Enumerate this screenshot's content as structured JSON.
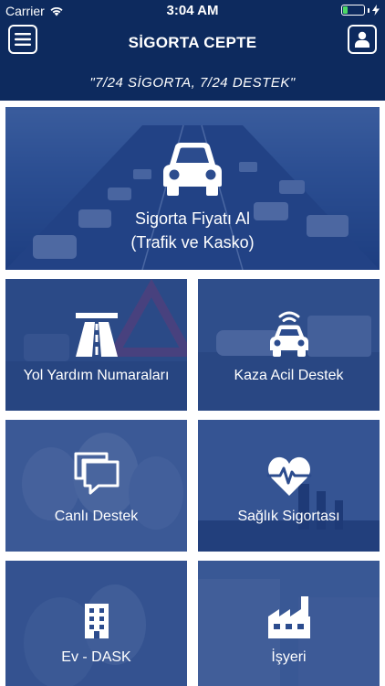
{
  "status_bar": {
    "carrier": "Carrier",
    "time": "3:04 AM",
    "battery_level": 0.3
  },
  "nav": {
    "title": "SİGORTA CEPTE",
    "left_icon": "menu-icon",
    "right_icon": "user-icon"
  },
  "slogan": "\"7/24 SİGORTA, 7/24 DESTEK\"",
  "hero": {
    "line1": "Sigorta Fiyatı Al",
    "line2": "(Trafik ve Kasko)",
    "icon": "car-icon"
  },
  "tiles": [
    {
      "label": "Yol Yardım Numaraları",
      "icon": "road-icon"
    },
    {
      "label": "Kaza Acil Destek",
      "icon": "connected-car-icon"
    },
    {
      "label": "Canlı Destek",
      "icon": "chat-bubbles-icon"
    },
    {
      "label": "Sağlık Sigortası",
      "icon": "heart-pulse-icon"
    },
    {
      "label": "Ev - DASK",
      "icon": "building-icon"
    },
    {
      "label": "İşyeri",
      "icon": "factory-icon"
    }
  ],
  "colors": {
    "header_bg": "#0d2a5e",
    "tile_overlay": "#1e3f8a",
    "battery": "#4cd964"
  }
}
